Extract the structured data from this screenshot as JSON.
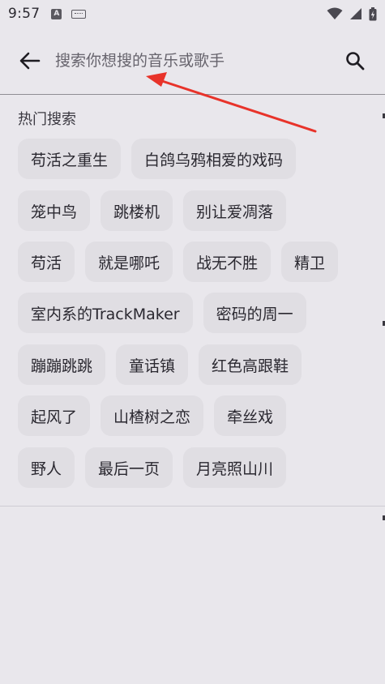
{
  "status_bar": {
    "time": "9:57",
    "app_icon": "A",
    "icons": [
      "app-notification-icon",
      "keyboard-icon",
      "wifi-icon",
      "signal-icon",
      "battery-icon"
    ]
  },
  "search": {
    "placeholder": "搜索你想搜的音乐或歌手",
    "value": ""
  },
  "hot_search": {
    "title": "热门搜索",
    "rows": [
      [
        "苟活之重生",
        "白鸽乌鸦相爱的戏码"
      ],
      [
        "笼中鸟",
        "跳楼机",
        "别让爱凋落"
      ],
      [
        "苟活",
        "就是哪吒",
        "战无不胜",
        "精卫"
      ],
      [
        "室内系的TrackMaker",
        "密码的周一"
      ],
      [
        "蹦蹦跳跳",
        "童话镇",
        "红色高跟鞋"
      ],
      [
        "起风了",
        "山楂树之恋",
        "牵丝戏"
      ],
      [
        "野人",
        "最后一页",
        "月亮照山川"
      ]
    ]
  },
  "colors": {
    "background": "#e9e7ec",
    "chip": "#e0dee3",
    "annotation_arrow": "#e8332a"
  }
}
